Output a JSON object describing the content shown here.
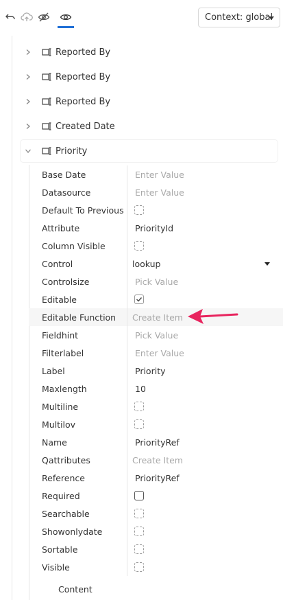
{
  "toolbar": {
    "context_label": "Context: global",
    "icons": [
      "undo-icon",
      "cloud-upload-icon",
      "eye-off-icon",
      "eye-icon"
    ]
  },
  "tree": {
    "nodes": [
      {
        "label": "Reported By",
        "expanded": false
      },
      {
        "label": "Reported By",
        "expanded": false
      },
      {
        "label": "Reported By",
        "expanded": false
      },
      {
        "label": "Created Date",
        "expanded": false
      },
      {
        "label": "Priority",
        "expanded": true
      }
    ]
  },
  "properties": [
    {
      "label": "Base Date",
      "type": "placeholder",
      "value": "Enter Value"
    },
    {
      "label": "Datasource",
      "type": "placeholder",
      "value": "Enter Value"
    },
    {
      "label": "Default To Previous",
      "type": "checkbox",
      "checked": false
    },
    {
      "label": "Attribute",
      "type": "text",
      "value": "PriorityId"
    },
    {
      "label": "Column Visible",
      "type": "checkbox",
      "checked": false
    },
    {
      "label": "Control",
      "type": "dropdown",
      "value": "lookup"
    },
    {
      "label": "Controlsize",
      "type": "placeholder",
      "value": "Pick Value"
    },
    {
      "label": "Editable",
      "type": "checkbox",
      "checked": true
    },
    {
      "label": "Editable Function",
      "type": "placeholder",
      "value": "Create Item"
    },
    {
      "label": "Fieldhint",
      "type": "placeholder",
      "value": "Pick Value"
    },
    {
      "label": "Filterlabel",
      "type": "placeholder",
      "value": "Enter Value"
    },
    {
      "label": "Label",
      "type": "text",
      "value": "Priority"
    },
    {
      "label": "Maxlength",
      "type": "text",
      "value": "10"
    },
    {
      "label": "Multiline",
      "type": "checkbox",
      "checked": false
    },
    {
      "label": "Multilov",
      "type": "checkbox",
      "checked": false
    },
    {
      "label": "Name",
      "type": "text",
      "value": "PriorityRef"
    },
    {
      "label": "Qattributes",
      "type": "placeholder",
      "value": "Create Item"
    },
    {
      "label": "Reference",
      "type": "text",
      "value": "PriorityRef"
    },
    {
      "label": "Required",
      "type": "checkbox",
      "checked": false,
      "solid": true
    },
    {
      "label": "Searchable",
      "type": "checkbox",
      "checked": false
    },
    {
      "label": "Showonlydate",
      "type": "checkbox",
      "checked": false
    },
    {
      "label": "Sortable",
      "type": "checkbox",
      "checked": false
    },
    {
      "label": "Visible",
      "type": "checkbox",
      "checked": false
    }
  ],
  "content_label": "Content",
  "colors": {
    "accent": "#1f6fd6",
    "arrow": "#e8245e",
    "placeholder": "#a8a8a8"
  }
}
